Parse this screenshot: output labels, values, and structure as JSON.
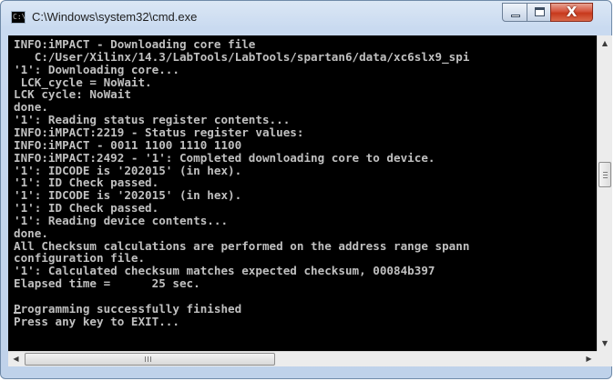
{
  "window": {
    "title": "C:\\Windows\\system32\\cmd.exe",
    "icon": "cmd-icon",
    "icon_text": "C:\\"
  },
  "controls": {
    "minimize": "minimize-icon",
    "maximize": "maximize-icon",
    "close": "close-icon",
    "close_glyph": "X"
  },
  "console": {
    "lines": [
      "INFO:iMPACT - Downloading core file",
      "   C:/User/Xilinx/14.3/LabTools/LabTools/spartan6/data/xc6slx9_spi",
      "'1': Downloading core...",
      " LCK_cycle = NoWait.",
      "LCK cycle: NoWait",
      "done.",
      "'1': Reading status register contents...",
      "INFO:iMPACT:2219 - Status register values:",
      "INFO:iMPACT - 0011 1100 1110 1100",
      "INFO:iMPACT:2492 - '1': Completed downloading core to device.",
      "'1': IDCODE is '202015' (in hex).",
      "'1': ID Check passed.",
      "'1': IDCODE is '202015' (in hex).",
      "'1': ID Check passed.",
      "'1': Reading device contents...",
      "done.",
      "All Checksum calculations are performed on the address range spann",
      "configuration file.",
      "'1': Calculated checksum matches expected checksum, 00084b397",
      "Elapsed time =      25 sec.",
      "",
      "Programming successfully finished",
      "Press any key to EXIT..."
    ],
    "text_color": "#c0c0c0",
    "background": "#000000"
  },
  "scrollbars": {
    "up_arrow": "▲",
    "down_arrow": "▼",
    "left_arrow": "◀",
    "right_arrow": "▶"
  },
  "colors": {
    "close_button": "#c7391c",
    "frame": "#c9daf0"
  }
}
